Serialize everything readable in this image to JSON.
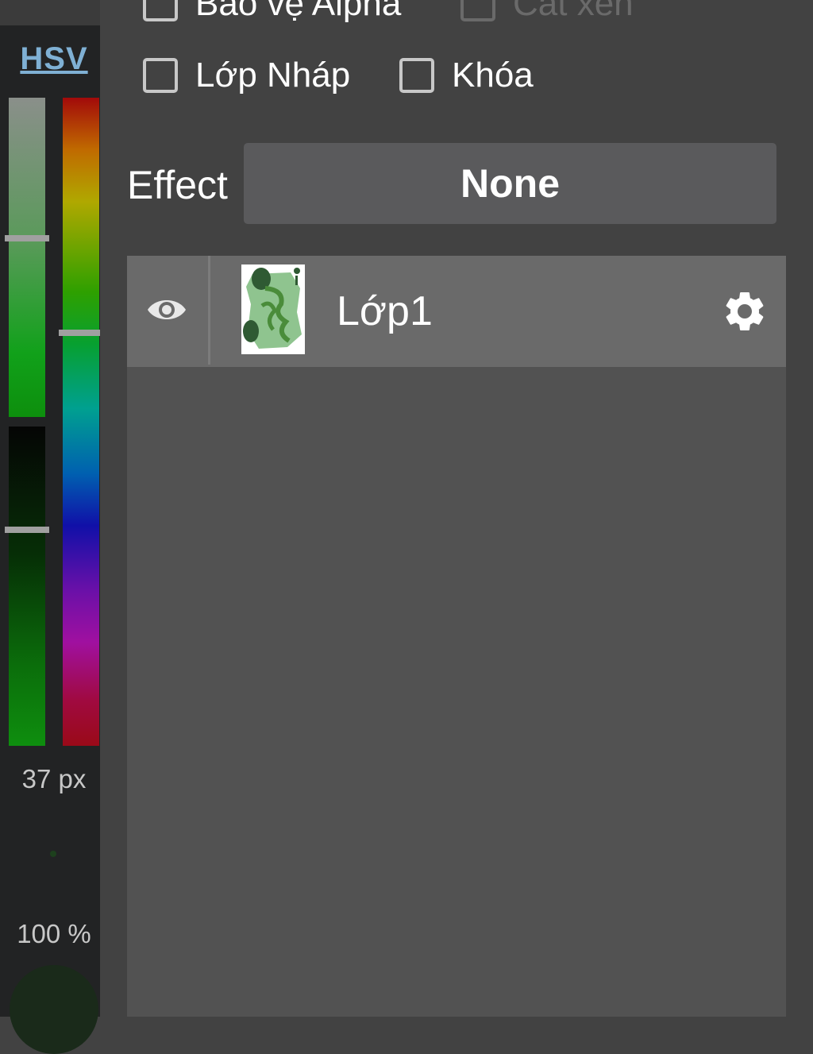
{
  "color_panel": {
    "mode_label": "HSV",
    "size_value": "37 px",
    "opacity_value": "100 %",
    "colors": {
      "current": "#1d401d",
      "hue_marker": "#0a9a50"
    }
  },
  "layer_options": {
    "alpha_protect": {
      "label": "Bảo vệ Alpha",
      "checked": false
    },
    "clipping": {
      "label": "Cắt xén",
      "checked": false,
      "disabled": true
    },
    "draft_layer": {
      "label": "Lớp Nháp",
      "checked": false
    },
    "lock": {
      "label": "Khóa",
      "checked": false
    }
  },
  "effect": {
    "label": "Effect",
    "value": "None"
  },
  "layers": [
    {
      "name": "Lớp1",
      "visible": true,
      "icons": [
        "eye-icon",
        "gear-icon"
      ]
    }
  ]
}
